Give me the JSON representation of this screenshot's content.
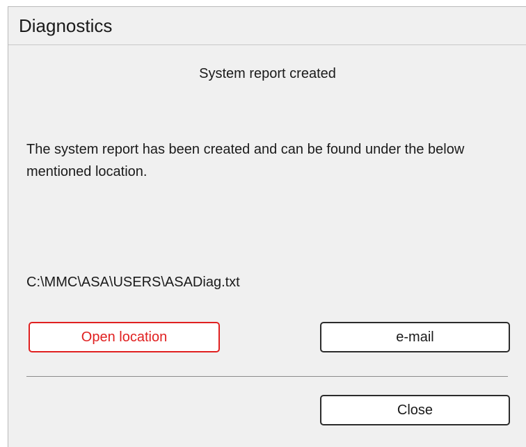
{
  "window": {
    "title": "Diagnostics"
  },
  "content": {
    "heading": "System report created",
    "message": "The system report has been created and can be found under the below mentioned location.",
    "path": "C:\\MMC\\ASA\\USERS\\ASADiag.txt"
  },
  "buttons": {
    "open_location": "Open location",
    "email": "e-mail",
    "close": "Close"
  },
  "colors": {
    "focus_accent": "#e02020",
    "dialog_background": "#f0f0f0"
  }
}
